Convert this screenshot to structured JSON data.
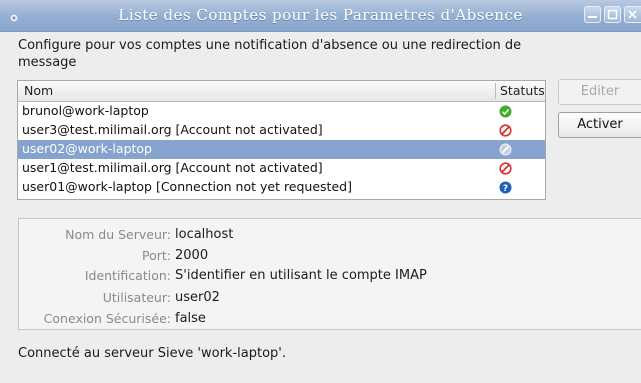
{
  "window": {
    "title": "Liste des Comptes pour les Parametres d'Absence"
  },
  "intro_text": "Configure pour vos comptes une notification d'absence ou une redirection de message",
  "table": {
    "columns": [
      "Nom",
      "Statuts"
    ],
    "rows": [
      {
        "name": "brunol@work-laptop",
        "status_icon": "check-icon",
        "status_color": "#3fae2a"
      },
      {
        "name": "user3@test.milimail.org [Account not activated]",
        "status_icon": "not-activated-icon",
        "status_color": "#d9312b"
      },
      {
        "name": "user02@work-laptop",
        "status_icon": "disabled-icon",
        "status_color": "#9aa6b8",
        "selected": true
      },
      {
        "name": "user1@test.milimail.org [Account not activated]",
        "status_icon": "not-activated-icon",
        "status_color": "#d9312b"
      },
      {
        "name": "user01@work-laptop [Connection not yet requested]",
        "status_icon": "question-icon",
        "status_color": "#1f5fb8"
      }
    ]
  },
  "buttons": {
    "edit": "Editer",
    "activate": "Activer"
  },
  "details": {
    "server_label": "Nom du Serveur:",
    "server_value": "localhost",
    "port_label": "Port:",
    "port_value": "2000",
    "auth_label": "Identification:",
    "auth_value": "S'identifier en utilisant le compte IMAP",
    "user_label": "Utilisateur:",
    "user_value": "user02",
    "secure_label": "Conexion Sécurisée:",
    "secure_value": "false"
  },
  "status_text": "Connecté au serveur Sieve 'work-laptop'.",
  "colors": {
    "titlebar": "#93aed2",
    "selection": "#86a3cf"
  }
}
